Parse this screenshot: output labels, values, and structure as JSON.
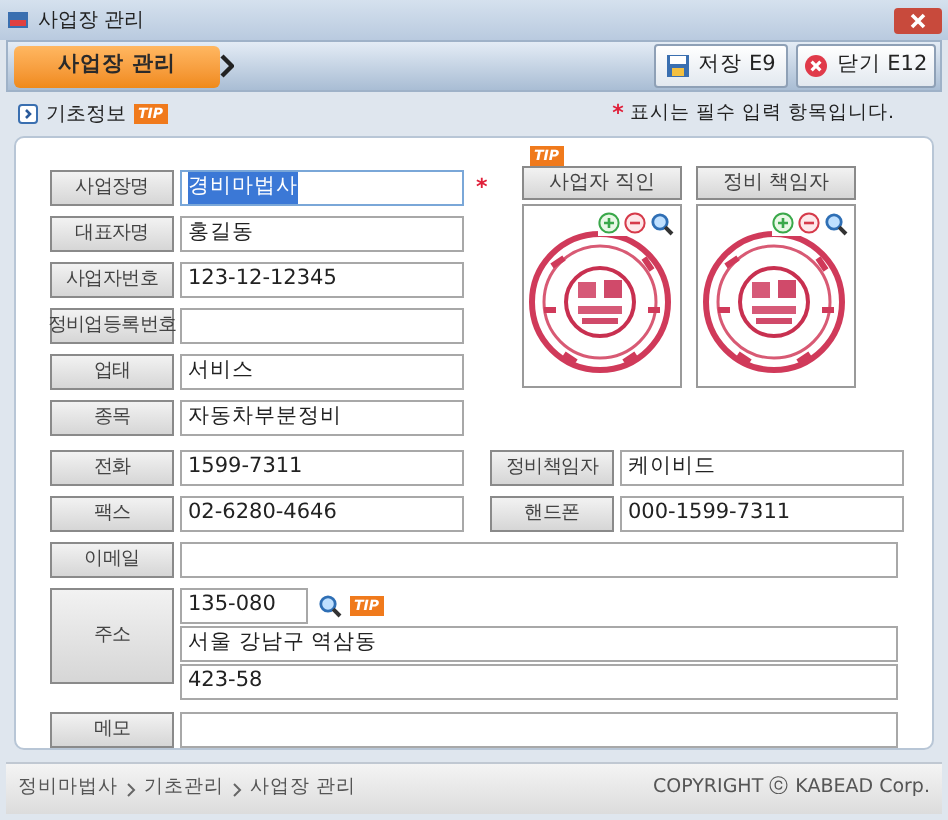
{
  "window": {
    "title": "사업장 관리"
  },
  "toolbar": {
    "tab": "사업장 관리",
    "buttons": [
      {
        "kind": "save",
        "label": "저장 E9"
      },
      {
        "kind": "close",
        "label": "닫기 E12"
      }
    ]
  },
  "section": {
    "title": "기초정보",
    "tip": "TIP",
    "required_note": {
      "mark": "*",
      "text": "표시는 필수 입력 항목입니다."
    }
  },
  "fields": [
    {
      "label": "사업장명",
      "value": "경비마법사",
      "highlighted": true,
      "mark": "*"
    },
    {
      "label": "대표자명",
      "value": "홍길동",
      "highlighted": false
    },
    {
      "label": "사업자번호",
      "value": "123-12-12345",
      "highlighted": false
    },
    {
      "label": "정비업등록번호",
      "highlighted": false
    },
    {
      "label": "업태",
      "value": "서비스",
      "highlighted": false
    },
    {
      "label": "종목",
      "value": "자동차부분정비",
      "highlighted": false
    }
  ],
  "stamps": {
    "tip": "TIP",
    "items": [
      {
        "label": "사업자 직인",
        "kind": "picture"
      },
      {
        "label": "정비 책임자",
        "kind": "picture"
      }
    ]
  },
  "pair_rows": [
    [
      {
        "label": "전화",
        "value": "1599-7311"
      },
      {
        "label": "정비책임자",
        "value": "케이비드"
      }
    ],
    [
      {
        "label": "팩스",
        "value": "02-6280-4646"
      },
      {
        "label": "핸드폰",
        "value": "000-1599-7311"
      }
    ]
  ],
  "email": {
    "label": "이메일"
  },
  "address": {
    "label": "주소",
    "zip": "135-080",
    "tip": "TIP",
    "line1": "서울 강남구 역삼동",
    "line2": "423-58"
  },
  "memo": {
    "label": "메모"
  },
  "status_bar": {
    "breadcrumb": [
      "정비마법사",
      "기초관리",
      "사업장 관리"
    ],
    "copyright": "COPYRIGHT ⓒ KABEAD Corp."
  }
}
